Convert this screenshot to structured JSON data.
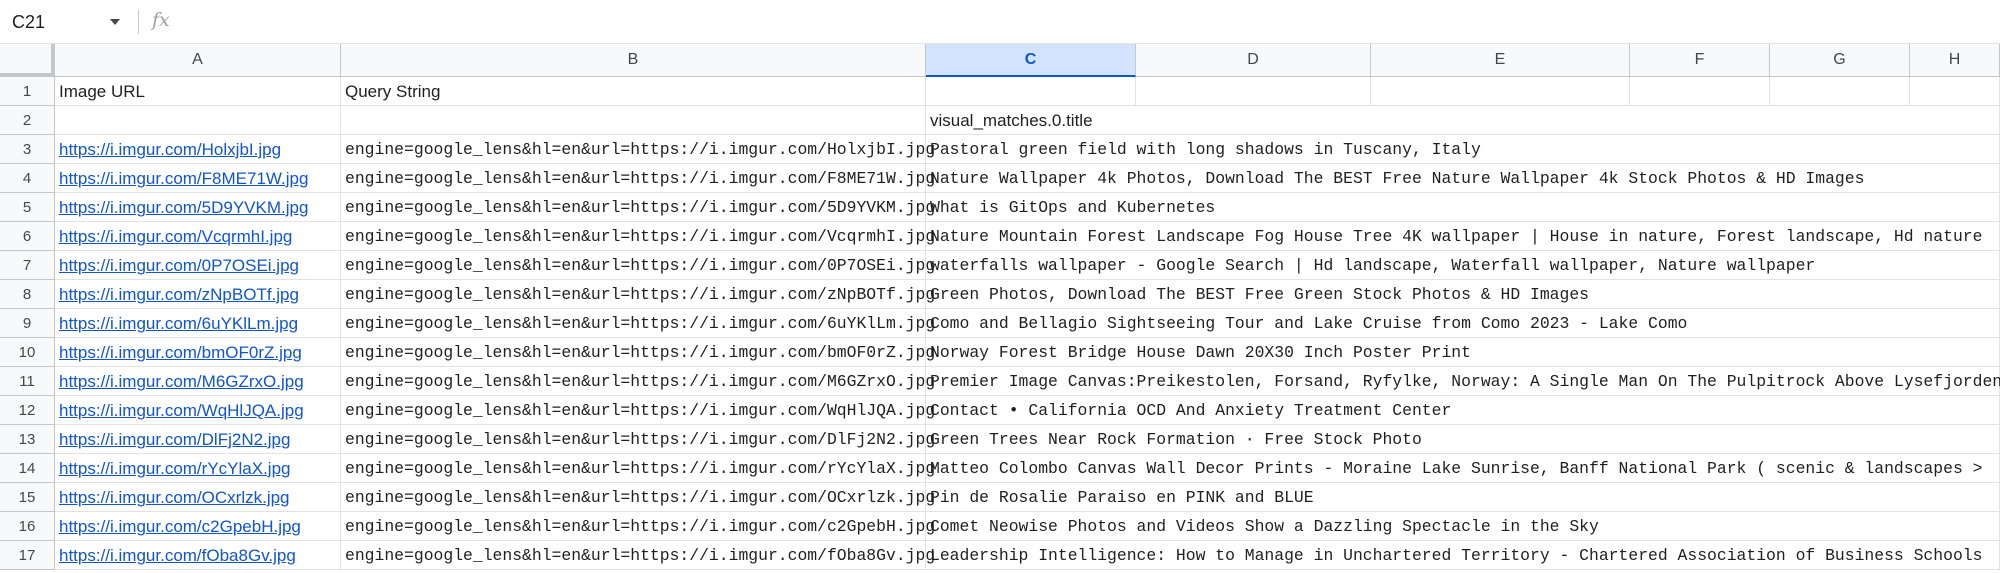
{
  "name_box": {
    "value": "C21",
    "dropdown_icon": "chevron-down-icon"
  },
  "formula_bar": {
    "fx_label": "fx",
    "value": ""
  },
  "columns": [
    "A",
    "B",
    "C",
    "D",
    "E",
    "F",
    "G",
    "H"
  ],
  "selected_column": "C",
  "rows": [
    {
      "num": "1",
      "a": "Image URL",
      "b": "Query String",
      "c": ""
    },
    {
      "num": "2",
      "a": "",
      "b": "",
      "c": "visual_matches.0.title"
    },
    {
      "num": "3",
      "a": "https://i.imgur.com/HolxjbI.jpg",
      "b": "engine=google_lens&hl=en&url=https://i.imgur.com/HolxjbI.jpg",
      "c": "Pastoral green field with long shadows in Tuscany, Italy"
    },
    {
      "num": "4",
      "a": "https://i.imgur.com/F8ME71W.jpg",
      "b": "engine=google_lens&hl=en&url=https://i.imgur.com/F8ME71W.jpg",
      "c": "Nature Wallpaper 4k Photos, Download The BEST Free Nature Wallpaper 4k Stock Photos & HD Images"
    },
    {
      "num": "5",
      "a": "https://i.imgur.com/5D9YVKM.jpg",
      "b": "engine=google_lens&hl=en&url=https://i.imgur.com/5D9YVKM.jpg",
      "c": "What is GitOps and Kubernetes"
    },
    {
      "num": "6",
      "a": "https://i.imgur.com/VcqrmhI.jpg",
      "b": "engine=google_lens&hl=en&url=https://i.imgur.com/VcqrmhI.jpg",
      "c": "Nature Mountain Forest Landscape Fog House Tree 4K wallpaper | House in nature, Forest landscape, Hd nature"
    },
    {
      "num": "7",
      "a": "https://i.imgur.com/0P7OSEi.jpg",
      "b": "engine=google_lens&hl=en&url=https://i.imgur.com/0P7OSEi.jpg",
      "c": "waterfalls wallpaper - Google Search | Hd landscape, Waterfall wallpaper, Nature wallpaper"
    },
    {
      "num": "8",
      "a": "https://i.imgur.com/zNpBOTf.jpg",
      "b": "engine=google_lens&hl=en&url=https://i.imgur.com/zNpBOTf.jpg",
      "c": "Green Photos, Download The BEST Free Green Stock Photos & HD Images"
    },
    {
      "num": "9",
      "a": "https://i.imgur.com/6uYKlLm.jpg",
      "b": "engine=google_lens&hl=en&url=https://i.imgur.com/6uYKlLm.jpg",
      "c": "Como and Bellagio Sightseeing Tour and Lake Cruise from Como 2023 - Lake Como"
    },
    {
      "num": "10",
      "a": "https://i.imgur.com/bmOF0rZ.jpg",
      "b": "engine=google_lens&hl=en&url=https://i.imgur.com/bmOF0rZ.jpg",
      "c": "Norway Forest Bridge House Dawn 20X30 Inch Poster Print"
    },
    {
      "num": "11",
      "a": "https://i.imgur.com/M6GZrxO.jpg",
      "b": "engine=google_lens&hl=en&url=https://i.imgur.com/M6GZrxO.jpg",
      "c": "Premier Image Canvas:Preikestolen, Forsand, Ryfylke, Norway: A Single Man On The Pulpitrock Above Lysefjorden"
    },
    {
      "num": "12",
      "a": "https://i.imgur.com/WqHlJQA.jpg",
      "b": "engine=google_lens&hl=en&url=https://i.imgur.com/WqHlJQA.jpg",
      "c": "Contact • California OCD And Anxiety Treatment Center"
    },
    {
      "num": "13",
      "a": "https://i.imgur.com/DlFj2N2.jpg",
      "b": "engine=google_lens&hl=en&url=https://i.imgur.com/DlFj2N2.jpg",
      "c": "Green Trees Near Rock Formation · Free Stock Photo"
    },
    {
      "num": "14",
      "a": "https://i.imgur.com/rYcYlaX.jpg",
      "b": "engine=google_lens&hl=en&url=https://i.imgur.com/rYcYlaX.jpg",
      "c": "Matteo Colombo Canvas Wall Decor Prints - Moraine Lake Sunrise, Banff National Park ( scenic & landscapes >"
    },
    {
      "num": "15",
      "a": "https://i.imgur.com/OCxrlzk.jpg",
      "b": "engine=google_lens&hl=en&url=https://i.imgur.com/OCxrlzk.jpg",
      "c": "Pin de Rosalie Paraiso en PINK and BLUE"
    },
    {
      "num": "16",
      "a": "https://i.imgur.com/c2GpebH.jpg",
      "b": "engine=google_lens&hl=en&url=https://i.imgur.com/c2GpebH.jpg",
      "c": "Comet Neowise Photos and Videos Show a Dazzling Spectacle in the Sky"
    },
    {
      "num": "17",
      "a": "https://i.imgur.com/fOba8Gv.jpg",
      "b": "engine=google_lens&hl=en&url=https://i.imgur.com/fOba8Gv.jpg",
      "c": "Leadership Intelligence: How to Manage in Unchartered Territory - Chartered Association of Business Schools"
    }
  ]
}
